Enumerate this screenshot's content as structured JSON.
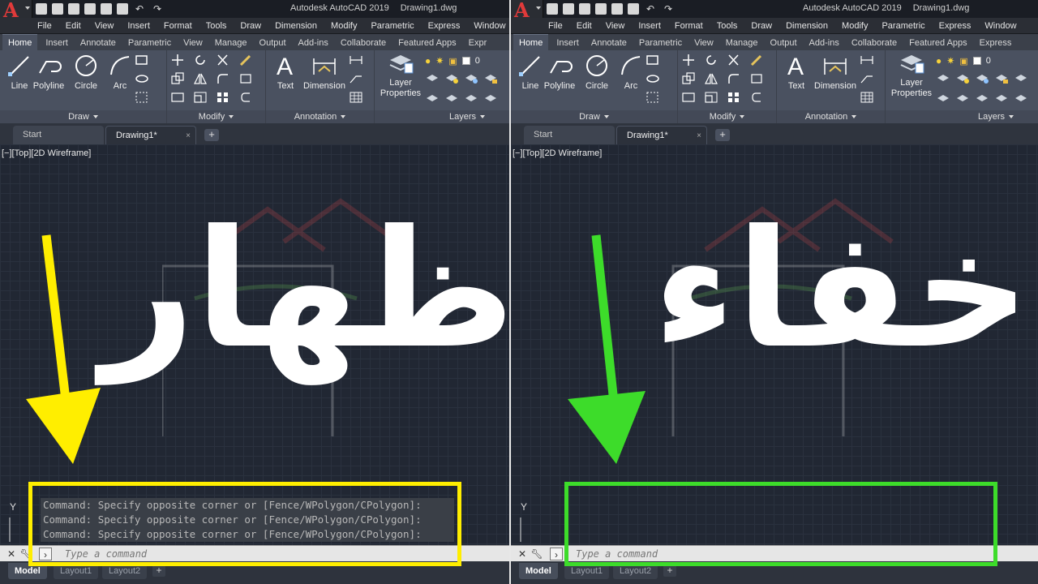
{
  "colors": {
    "yellow": "#ffee00",
    "green": "#3ddc2a",
    "autocad_red": "#e03a3a"
  },
  "app_title": "Autodesk AutoCAD 2019",
  "drawing_title": "Drawing1.dwg",
  "menu": [
    "File",
    "Edit",
    "View",
    "Insert",
    "Format",
    "Tools",
    "Draw",
    "Dimension",
    "Modify",
    "Parametric",
    "Express",
    "Window"
  ],
  "ribbon_tabs": [
    "Home",
    "Insert",
    "Annotate",
    "Parametric",
    "View",
    "Manage",
    "Output",
    "Add-ins",
    "Collaborate",
    "Featured Apps",
    "Express"
  ],
  "ribbon_tabs_left_last": "Expr",
  "draw_tools": [
    "Line",
    "Polyline",
    "Circle",
    "Arc"
  ],
  "annotation_tools": [
    "Text",
    "Dimension"
  ],
  "layer_tool": [
    "Layer",
    "Properties"
  ],
  "layer_value": "0",
  "groups": {
    "draw": "Draw",
    "modify": "Modify",
    "annotation": "Annotation",
    "layers": "Layers"
  },
  "doc_tabs": {
    "start": "Start",
    "drawing": "Drawing1*",
    "close": "×",
    "new": "+"
  },
  "viewport_label": "[−][Top][2D Wireframe]",
  "left_panel": {
    "overlay_word": "اظهار",
    "command_history": [
      "Command: Specify opposite corner or [Fence/WPolygon/CPolygon]:",
      "Command: Specify opposite corner or [Fence/WPolygon/CPolygon]:",
      "Command: Specify opposite corner or [Fence/WPolygon/CPolygon]:"
    ]
  },
  "right_panel": {
    "overlay_word": "اخفاء"
  },
  "command_placeholder": "Type a command",
  "ucs_y": "Y",
  "layout_tabs": [
    "Model",
    "Layout1",
    "Layout2"
  ],
  "layout_add": "+",
  "icons": {
    "ribbon_arrow_left": "undo-icon",
    "app_menu": "autocad-a-icon"
  }
}
